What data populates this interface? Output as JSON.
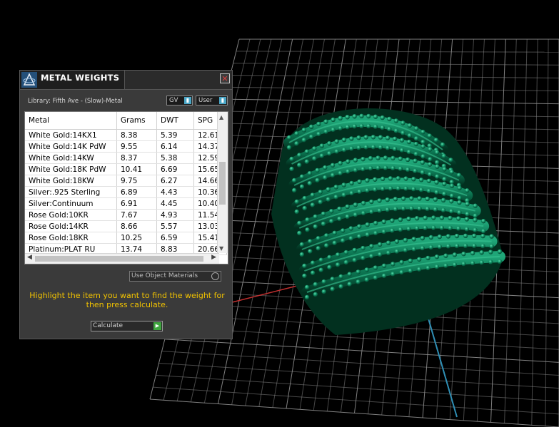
{
  "panel": {
    "title": "METAL WEIGHTS",
    "close_glyph": "✕",
    "library_label": "Library: Fifth Ave - (Slow)-Metal",
    "gv_select": "GV",
    "user_select": "User",
    "table": {
      "headers": [
        "Metal",
        "Grams",
        "DWT",
        "SPG"
      ],
      "rows": [
        [
          "White Gold:14KX1",
          "8.38",
          "5.39",
          "12.61"
        ],
        [
          "White Gold:14K PdW",
          "9.55",
          "6.14",
          "14.37"
        ],
        [
          "White Gold:14KW",
          "8.37",
          "5.38",
          "12.59"
        ],
        [
          "White Gold:18K PdW",
          "10.41",
          "6.69",
          "15.65"
        ],
        [
          "White Gold:18KW",
          "9.75",
          "6.27",
          "14.66"
        ],
        [
          "Silver:.925 Sterling",
          "6.89",
          "4.43",
          "10.36"
        ],
        [
          "Silver:Continuum",
          "6.91",
          "4.45",
          "10.40"
        ],
        [
          "Rose Gold:10KR",
          "7.67",
          "4.93",
          "11.54"
        ],
        [
          "Rose Gold:14KR",
          "8.66",
          "5.57",
          "13.03"
        ],
        [
          "Rose Gold:18KR",
          "10.25",
          "6.59",
          "15.41"
        ],
        [
          "Platinum:PLAT RU",
          "13.74",
          "8.83",
          "20.66"
        ]
      ]
    },
    "use_object_materials": "Use Object Materials",
    "hint": "Highlight the item you want to find the weight for then press calculate.",
    "calculate_button": "Calculate"
  },
  "icons": {
    "app": "app-logo-icon",
    "close": "close-icon",
    "dropdown": "chevron-down-icon",
    "calculate": "play-arrow-icon"
  },
  "colors": {
    "panel_bg": "#3a3a3a",
    "hint_text": "#f2c300",
    "ring_green": "#0b7a55",
    "grid_line": "#9a9a9a"
  }
}
